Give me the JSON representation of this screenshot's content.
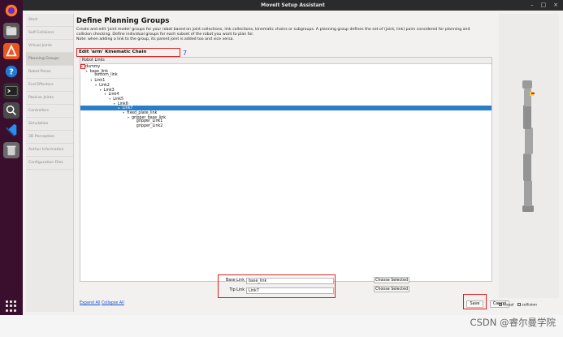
{
  "window": {
    "title": "MoveIt Setup Assistant",
    "controls": [
      "–",
      "□",
      "×"
    ]
  },
  "dock": {
    "icons": [
      "firefox-icon",
      "files-icon",
      "software-icon",
      "help-icon",
      "terminal-icon",
      "search-icon",
      "vscode-icon",
      "trash-icon",
      "apps-grid-icon"
    ]
  },
  "sidebar": {
    "items": [
      {
        "label": "Start"
      },
      {
        "label": "Self-Collisions"
      },
      {
        "label": "Virtual Joints"
      },
      {
        "label": "Planning Groups"
      },
      {
        "label": "Robot Poses"
      },
      {
        "label": "End Effectors"
      },
      {
        "label": "Passive Joints"
      },
      {
        "label": "Controllers"
      },
      {
        "label": "Simulation"
      },
      {
        "label": "3D Perception"
      },
      {
        "label": "Author Information"
      },
      {
        "label": "Configuration Files"
      }
    ],
    "active_index": 3
  },
  "main": {
    "heading": "Define Planning Groups",
    "description_line1": "Create and edit 'joint model' groups for your robot based on joint collections, link collections, kinematic chains or subgroups. A planning group defines the set of (joint, link) pairs considered for planning and",
    "description_line2": "collision checking. Define individual groups for each subset of the robot you want to plan for.",
    "description_line3": "Note: when adding a link to the group, its parent joint is added too and vice versa.",
    "edit_label": "Edit 'arm' Kinematic Chain",
    "annotation": "7"
  },
  "tree": {
    "header": "Robot Links",
    "nodes": [
      {
        "label": "dummy",
        "depth": 0,
        "expanded": true
      },
      {
        "label": "base_link",
        "depth": 1,
        "expanded": true
      },
      {
        "label": "bottom_link",
        "depth": 2,
        "leaf": true
      },
      {
        "label": "Link1",
        "depth": 2,
        "expanded": true
      },
      {
        "label": "Link2",
        "depth": 3,
        "expanded": true
      },
      {
        "label": "Link3",
        "depth": 4,
        "expanded": true
      },
      {
        "label": "Link4",
        "depth": 5,
        "expanded": true
      },
      {
        "label": "Link5",
        "depth": 6,
        "expanded": true
      },
      {
        "label": "Link6",
        "depth": 7,
        "expanded": true
      },
      {
        "label": "Link7",
        "depth": 8,
        "expanded": false,
        "selected": true
      },
      {
        "label": "fixed_plate_link",
        "depth": 9,
        "expanded": true
      },
      {
        "label": "gripper_base_link",
        "depth": 10,
        "expanded": true
      },
      {
        "label": "gripper_Link1",
        "depth": 11,
        "leaf": true
      },
      {
        "label": "gripper_Link2",
        "depth": 11,
        "leaf": true
      }
    ]
  },
  "links": {
    "base_label": "Base Link",
    "base_value": "base_link",
    "tip_label": "Tip Link",
    "tip_value": "Link7",
    "choose_selected": "Choose Selected"
  },
  "footer": {
    "expand_all": "Expand All",
    "collapse_all": "Collapse All",
    "save": "Save",
    "cancel": "Cancel"
  },
  "view": {
    "visual_label": "visual",
    "visual_checked": true,
    "visual_mark": "✓",
    "collision_label": "collision",
    "collision_checked": false
  },
  "watermark": "CSDN @睿尔曼学院",
  "colors": {
    "highlight_red": "#e02020",
    "selection_blue": "#2a7ec8",
    "annotation_blue": "#3a4bd8",
    "robot_gray": "#8c8c8c",
    "robot_yellow": "#f2d23a"
  }
}
